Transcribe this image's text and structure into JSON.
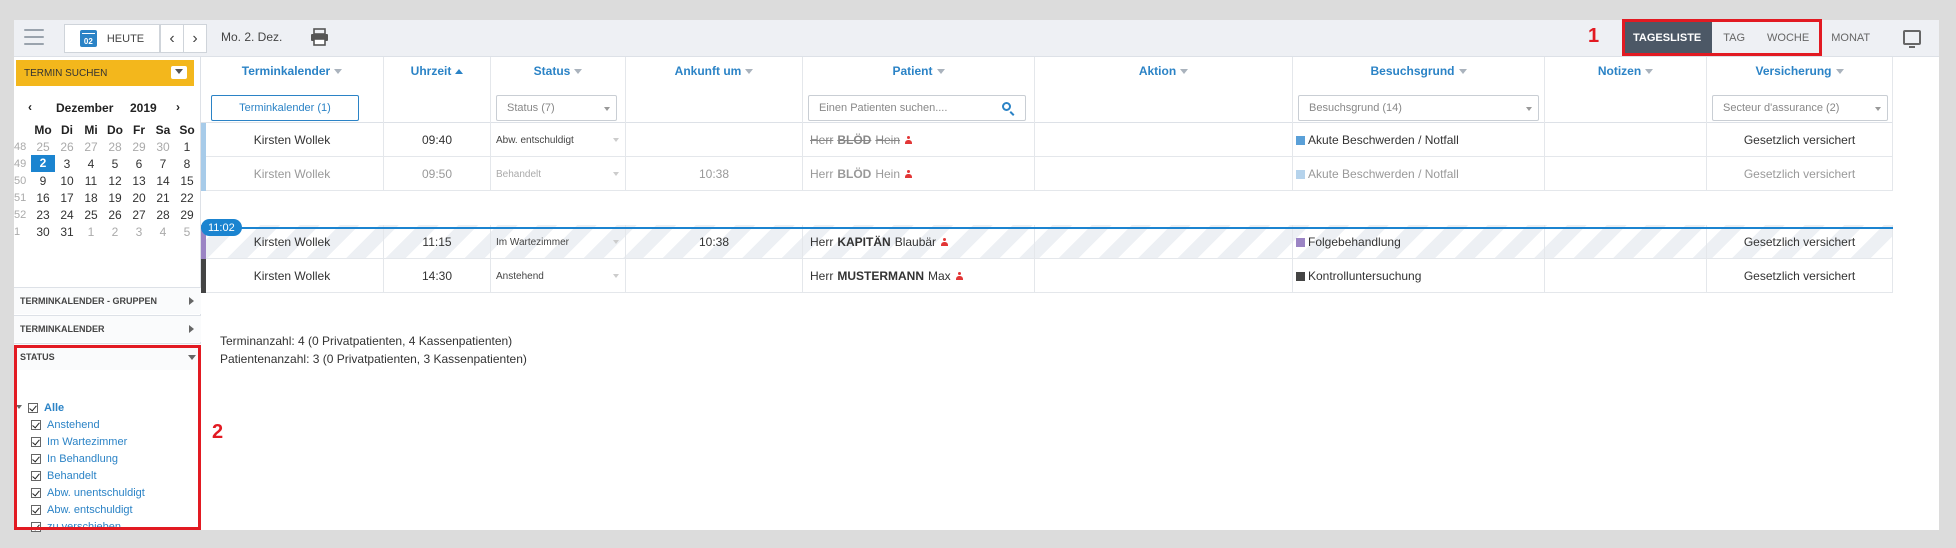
{
  "toolbar": {
    "today_label": "HEUTE",
    "calendar_icon_day": "02",
    "prev": "‹",
    "next": "›",
    "current_date": "Mo. 2. Dez.",
    "views": [
      "TAGESLISTE",
      "TAG",
      "WOCHE",
      "MONAT"
    ],
    "active_view": "TAGESLISTE"
  },
  "annotations": {
    "one": "1",
    "two": "2"
  },
  "sidebar": {
    "termin_suchen": "TERMIN SUCHEN",
    "calendar": {
      "prev": "‹",
      "next": "›",
      "month": "Dezember",
      "year": "2019",
      "weekdays": [
        "Mo",
        "Di",
        "Mi",
        "Do",
        "Fr",
        "Sa",
        "So"
      ],
      "weeks": [
        {
          "wk": "48",
          "days": [
            "25",
            "26",
            "27",
            "28",
            "29",
            "30",
            "1"
          ]
        },
        {
          "wk": "49",
          "days": [
            "2",
            "3",
            "4",
            "5",
            "6",
            "7",
            "8"
          ]
        },
        {
          "wk": "50",
          "days": [
            "9",
            "10",
            "11",
            "12",
            "13",
            "14",
            "15"
          ]
        },
        {
          "wk": "51",
          "days": [
            "16",
            "17",
            "18",
            "19",
            "20",
            "21",
            "22"
          ]
        },
        {
          "wk": "52",
          "days": [
            "23",
            "24",
            "25",
            "26",
            "27",
            "28",
            "29"
          ]
        },
        {
          "wk": "1",
          "days": [
            "30",
            "31",
            "1",
            "2",
            "3",
            "4",
            "5"
          ]
        }
      ]
    },
    "sections": {
      "gruppen": "TERMINKALENDER - GRUPPEN",
      "terminkalender": "TERMINKALENDER",
      "status": "STATUS"
    },
    "status_items": [
      "Alle",
      "Anstehend",
      "Im Wartezimmer",
      "In Behandlung",
      "Behandelt",
      "Abw. unentschuldigt",
      "Abw. entschuldigt",
      "zu verschieben"
    ]
  },
  "table": {
    "headers": {
      "terminkalender": "Terminkalender",
      "uhrzeit": "Uhrzeit",
      "status": "Status",
      "ankunft": "Ankunft um",
      "patient": "Patient",
      "aktion": "Aktion",
      "besuchsgrund": "Besuchsgrund",
      "notizen": "Notizen",
      "versicherung": "Versicherung"
    },
    "filters": {
      "terminkalender": "Terminkalender (1)",
      "status": "Status (7)",
      "patient_placeholder": "Einen Patienten suchen....",
      "besuchsgrund": "Besuchsgrund (14)",
      "versicherung": "Secteur d'assurance (2)"
    },
    "rows": [
      {
        "kalender": "Kirsten Wollek",
        "zeit": "09:40",
        "status": "Abw. entschuldigt",
        "ankunft": "",
        "anrede": "Herr",
        "nachname": "BLÖD",
        "vorname": "Hein",
        "grund": "Akute Beschwerden / Notfall",
        "grund_color": "#5aa0d8",
        "bar_color": "#a7cbe9",
        "versicherung": "Gesetzlich versichert"
      },
      {
        "kalender": "Kirsten Wollek",
        "zeit": "09:50",
        "status": "Behandelt",
        "ankunft": "10:38",
        "anrede": "Herr",
        "nachname": "BLÖD",
        "vorname": "Hein",
        "grund": "Akute Beschwerden / Notfall",
        "grund_color": "#b5d3ec",
        "bar_color": "#a7cbe9",
        "versicherung": "Gesetzlich versichert"
      },
      {
        "kalender": "Kirsten Wollek",
        "zeit": "11:15",
        "status": "Im Wartezimmer",
        "ankunft": "10:38",
        "anrede": "Herr",
        "nachname": "KAPITÄN",
        "vorname": "Blaubär",
        "grund": "Folgebehandlung",
        "grund_color": "#9b84c4",
        "bar_color": "#9b84c4",
        "versicherung": "Gesetzlich versichert"
      },
      {
        "kalender": "Kirsten Wollek",
        "zeit": "14:30",
        "status": "Anstehend",
        "ankunft": "",
        "anrede": "Herr",
        "nachname": "MUSTERMANN",
        "vorname": "Max",
        "grund": "Kontrolluntersuchung",
        "grund_color": "#444444",
        "bar_color": "#444444",
        "versicherung": "Gesetzlich versichert"
      }
    ],
    "now_time": "11:02"
  },
  "summary": {
    "line1": "Terminanzahl: 4 (0 Privatpatienten, 4 Kassenpatienten)",
    "line2": "Patientenanzahl: 3 (0 Privatpatienten, 3 Kassenpatienten)"
  }
}
